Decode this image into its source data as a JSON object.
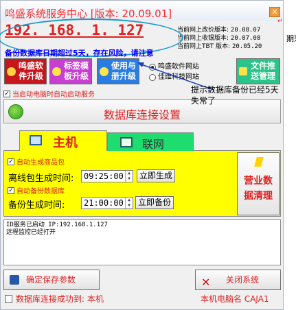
{
  "window": {
    "title": "鸣盛系统服务中心 [版本: 20.09.01]"
  },
  "ip": "192. 168. 1. 127",
  "versions": [
    {
      "label": "当前网上改价版本:",
      "value": "20.08.07"
    },
    {
      "label": "当前网上收银版本:",
      "value": "20.07.08"
    },
    {
      "label": "当前网上TBT 版本:",
      "value": "20.05.20"
    }
  ],
  "warning": "备份数据库日期超过5天，存在风险，请注意",
  "buttons": {
    "upgrade_software": [
      "鸣盛软",
      "件升级"
    ],
    "upgrade_template": [
      "标签模",
      "板升级"
    ],
    "upgrade_register": [
      "使用与",
      "册升级"
    ],
    "file_push": [
      "文件推",
      "送管理"
    ]
  },
  "radios": [
    {
      "label": "鸣盛软件网站",
      "checked": true
    },
    {
      "label": "佳维科技网站",
      "checked": false
    }
  ],
  "annotation": [
    "提示数据库备份已经5天",
    "失常了"
  ],
  "edge_fragments": {
    "top": "↵",
    "side": "期落"
  },
  "autostart": {
    "label": "当启动电脑时自动启动服务",
    "checked": true
  },
  "db_button": "数据库连接设置",
  "tabs": {
    "main": "主机",
    "net": "联网"
  },
  "panel": {
    "auto_gen_label": "自动生成商品包",
    "auto_gen_checked": true,
    "gen_time_label": "离线包生成时间:",
    "gen_time": "09:25:00",
    "gen_now": "立即生成",
    "auto_backup_label": "自动备份数据库",
    "auto_backup_checked": true,
    "backup_time_label": "备份生成时间:",
    "backup_time": "21:00:00",
    "backup_now": "立即备份",
    "business_clean": [
      "营业数",
      "据清理"
    ]
  },
  "log": "ID服务已启动 IP:192.168.1.127\n远程监控已经打开",
  "footer": {
    "save": "确定保存参数",
    "close": "关闭系统"
  },
  "status": {
    "left": "数据库连接成功到: 本机",
    "right": "本机电脑名 CAJA1"
  }
}
